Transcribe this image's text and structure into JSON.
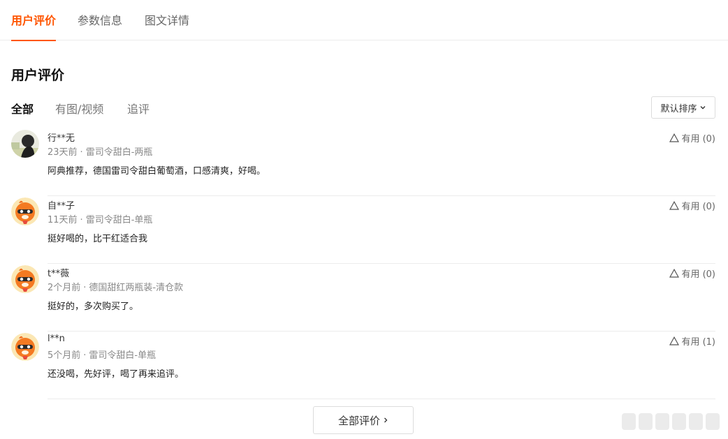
{
  "tabs": [
    "用户评价",
    "参数信息",
    "图文详情"
  ],
  "section_title": "用户评价",
  "filters": [
    "全部",
    "有图/视频",
    "追评"
  ],
  "sort_label": "默认排序",
  "colors": {
    "accent": "#ff5500"
  },
  "reviews": [
    {
      "user": "行**无",
      "time": "23天前",
      "variant": "雷司令甜白-两瓶",
      "content": "阿典推荐，德国雷司令甜白葡萄酒，口感清爽，好喝。",
      "useful": "有用 (0)",
      "avatar": "photo-avatar"
    },
    {
      "user": "自**子",
      "time": "11天前",
      "variant": "雷司令甜白-单瓶",
      "content": "挺好喝的，比干红适合我",
      "useful": "有用 (0)",
      "avatar": "mascot-avatar"
    },
    {
      "user": "t**薇",
      "time": "2个月前",
      "variant": "德国甜红两瓶装-清仓款",
      "content": "挺好的，多次购买了。",
      "useful": "有用 (0)",
      "avatar": "mascot-avatar"
    },
    {
      "user": "l**n",
      "time": "5个月前",
      "variant": "雷司令甜白-单瓶",
      "content": "还没喝，先好评，喝了再来追评。",
      "useful": "有用 (1)",
      "avatar": "mascot-avatar"
    }
  ],
  "all_reviews_label": "全部评价",
  "meta_separator": "·"
}
